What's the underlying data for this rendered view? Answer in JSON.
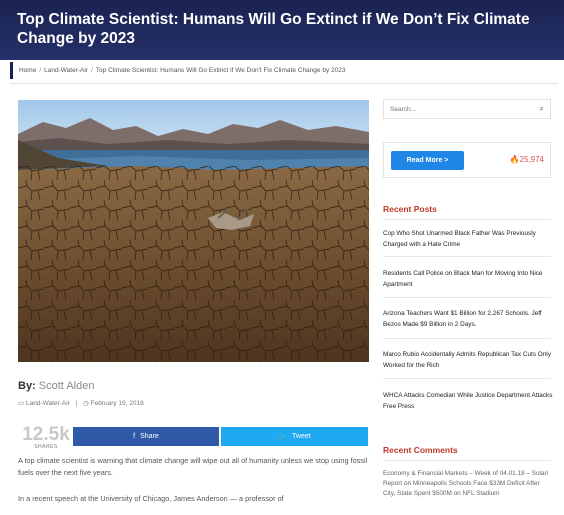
{
  "header": {
    "title": "Top Climate Scientist: Humans Will Go Extinct if We Don’t Fix Climate Change by 2023"
  },
  "breadcrumb": {
    "home": "Home",
    "category": "Land-Water-Air",
    "current": "Top Climate Scientist: Humans Will Go Extinct if We Don't Fix Climate Change by 2023"
  },
  "article": {
    "by_label": "By:",
    "author": "Scott Alden",
    "category": "Land-Water-Air",
    "date": "February 19, 2018",
    "shares_count": "12.5k",
    "shares_label": "SHARES",
    "share_label": "Share",
    "tweet_label": "Tweet",
    "paragraph1": "A top climate scientist is warning that climate change will wipe out all of humanity unless we stop using fossil fuels over the next five years.",
    "paragraph2": "In a recent speech at the University of Chicago, James Anderson — a professor of"
  },
  "sidebar": {
    "search_placeholder": "Search...",
    "read_more_label": "Read More >",
    "follow_count": "25,974",
    "recent_posts_title": "Recent Posts",
    "recent_posts": [
      "Cop Who Shot Unarmed Black Father Was Previously Charged with a Hate Crime",
      "Residents Call Police on Black Man for Moving Into Nice Apartment",
      "Arizona Teachers Want $1 Billion for 2,267 Schools. Jeff Bezos Made $9 Billion in 2 Days.",
      "Marco Rubio Accidentally Admits Republican Tax Cuts Only Worked for the Rich",
      "WHCA Attacks Comedian While Justice Department Attacks Free Press"
    ],
    "recent_comments_title": "Recent Comments",
    "comment": {
      "author": "Economy & Financial Markets – Week of 04.01.18 – Solari Report",
      "on_word": "on",
      "post": "Minneapolis Schools Face $33M Deficit After City, State Spent $500M on NFL Stadium"
    }
  },
  "colors": {
    "header_bg": "#1f2a5c",
    "accent_red": "#c0392b",
    "share_blue": "#2e5aa7",
    "tweet_blue": "#1ea9f1",
    "read_more_blue": "#1f86e6"
  },
  "icons": {
    "search": "search-icon",
    "facebook": "facebook-icon",
    "twitter": "twitter-icon",
    "flame": "flame-icon",
    "folder": "folder-icon",
    "clock": "clock-icon"
  }
}
